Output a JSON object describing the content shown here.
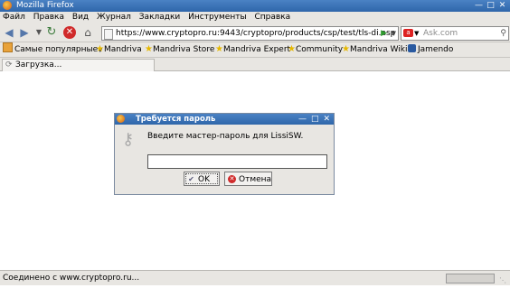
{
  "window": {
    "title": "Mozilla Firefox"
  },
  "menu": [
    "Файл",
    "Правка",
    "Вид",
    "Журнал",
    "Закладки",
    "Инструменты",
    "Справка"
  ],
  "navigation": {
    "url": "https://www.cryptopro.ru:9443/cryptopro/products/csp/test/tls-di.asp",
    "search_placeholder": "Ask.com"
  },
  "bookmarks": [
    {
      "label": "Самые популярные",
      "icon": "folder-icon",
      "has_dropdown": true
    },
    {
      "label": "Mandriva",
      "icon": "star-icon"
    },
    {
      "label": "Mandriva Store",
      "icon": "star-icon"
    },
    {
      "label": "Mandriva Expert",
      "icon": "star-icon"
    },
    {
      "label": "Community",
      "icon": "star-icon"
    },
    {
      "label": "Mandriva Wiki",
      "icon": "star-icon"
    },
    {
      "label": "Jamendo",
      "icon": "jamendo-icon"
    }
  ],
  "tab": {
    "label": "Загрузка..."
  },
  "status": {
    "text": "Соединено с www.cryptopro.ru..."
  },
  "dialog": {
    "title": "Требуется пароль",
    "message": "Введите мастер-пароль для LissiSW.",
    "password_value": "",
    "ok_label": "OK",
    "cancel_label": "Отмена"
  },
  "colors": {
    "titlebar": "#2f66aa",
    "chrome": "#e8e6e2",
    "stop": "#d02a2a"
  }
}
